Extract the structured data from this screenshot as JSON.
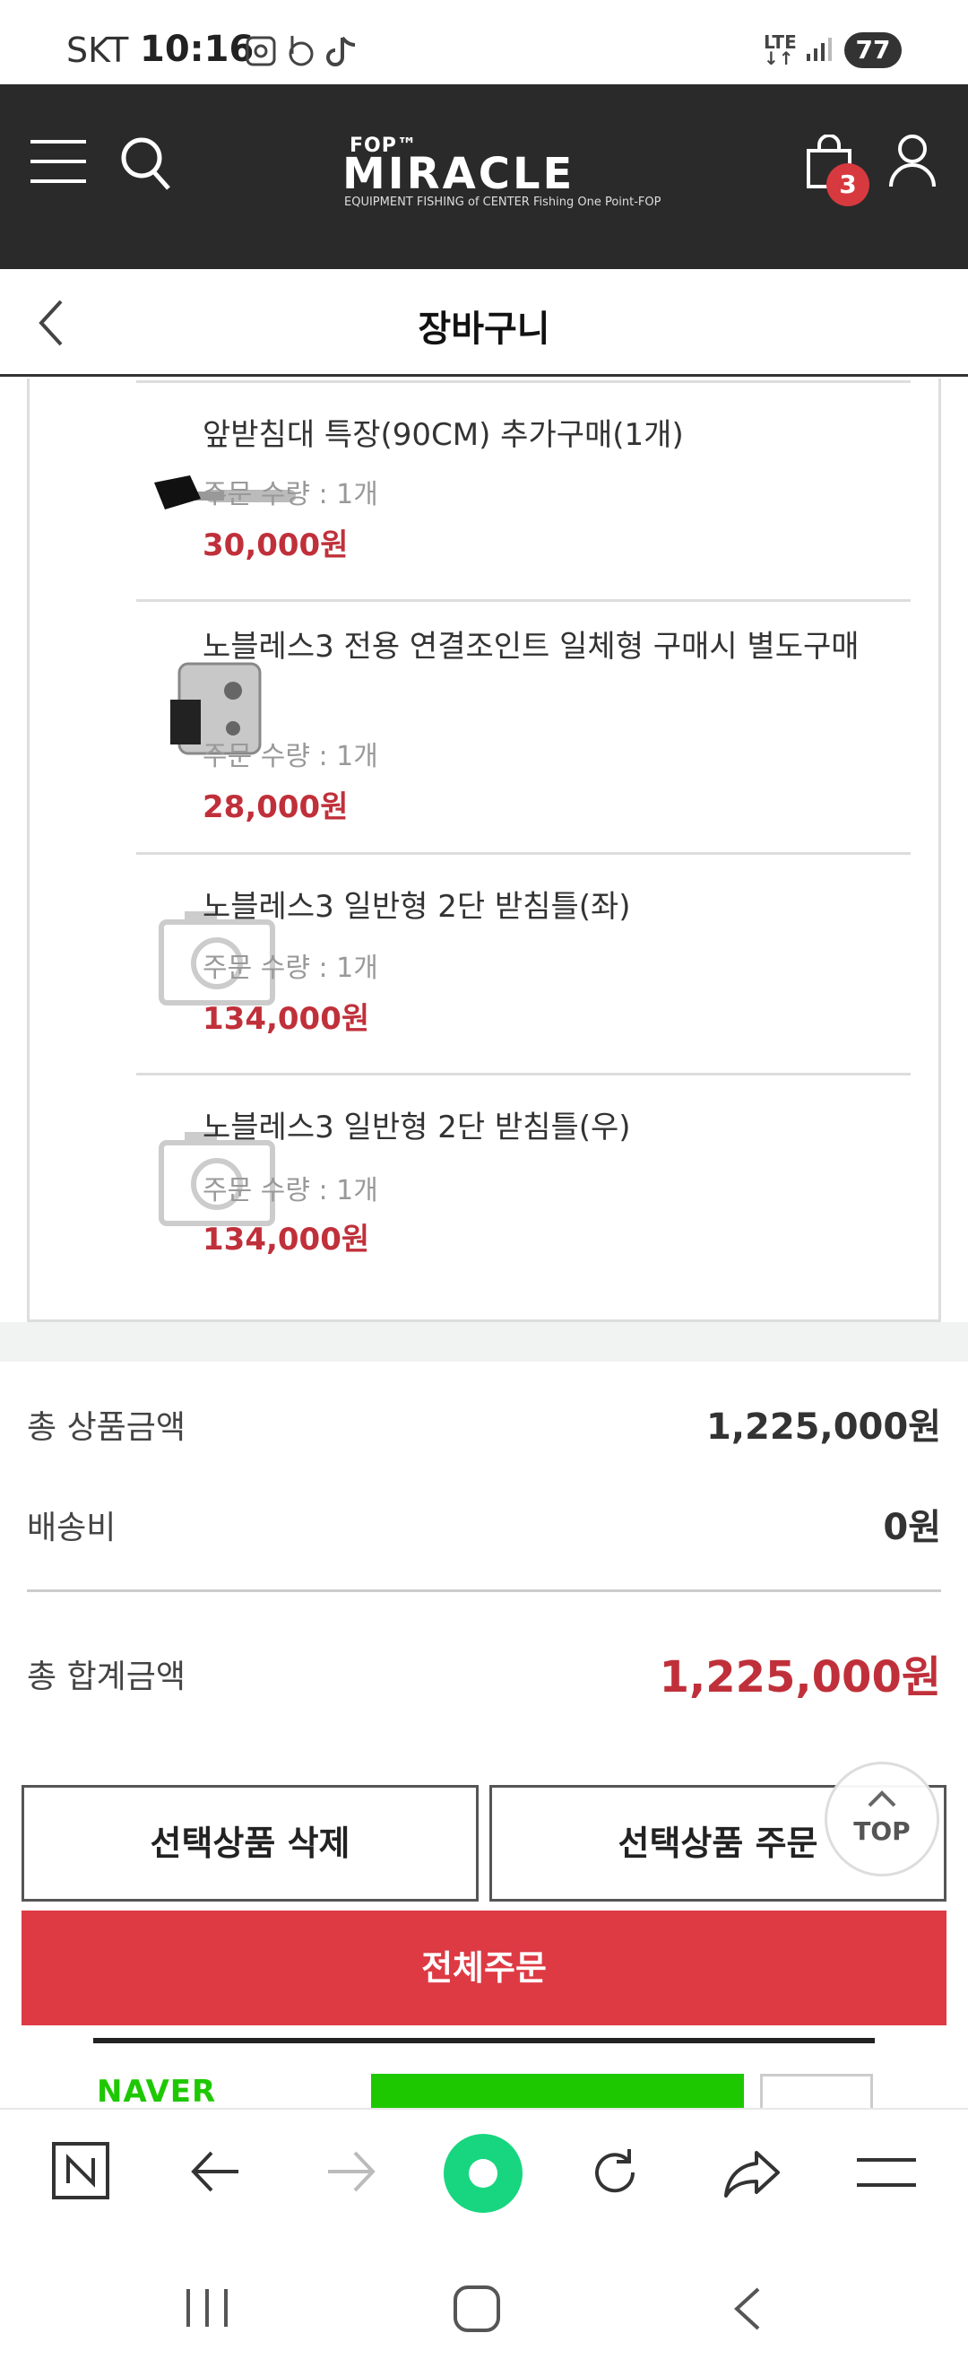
{
  "status": {
    "carrier": "SKT",
    "time": "10:16",
    "network": "LTE",
    "battery": "77"
  },
  "header": {
    "logo_top": "FOP™",
    "logo_main": "MIRACLE",
    "logo_sub": "EQUIPMENT FISHING of CENTER Fishing One Point-FOP",
    "cart_count": "3"
  },
  "page": {
    "title": "장바구니"
  },
  "cart_items": [
    {
      "name": "앞받침대 특장(90CM) 추가구매(1개)",
      "qty": "주문 수량 : 1개",
      "price": "30,000원"
    },
    {
      "name": "노블레스3 전용 연결조인트 일체형 구매시 별도구매",
      "qty": "주문 수량 : 1개",
      "price": "28,000원"
    },
    {
      "name": "노블레스3 일반형 2단 받침틀(좌)",
      "qty": "주문 수량 : 1개",
      "price": "134,000원"
    },
    {
      "name": "노블레스3 일반형 2단 받침틀(우)",
      "qty": "주문 수량 : 1개",
      "price": "134,000원"
    }
  ],
  "summary": {
    "product_total_label": "총 상품금액",
    "product_total_value": "1,225,000원",
    "shipping_label": "배송비",
    "shipping_value": "0원",
    "grand_total_label": "총 합계금액",
    "grand_total_value": "1,225,000원"
  },
  "buttons": {
    "delete_selected": "선택상품 삭제",
    "order_selected": "선택상품 주문",
    "order_all": "전체주문",
    "top": "TOP"
  },
  "naver": {
    "logo": "NAVER"
  },
  "colors": {
    "header_bg": "#2a2a2a",
    "accent_red": "#de3a44",
    "price_red": "#c0303a",
    "naver_green": "#1ec800",
    "browser_green": "#17d67f"
  }
}
